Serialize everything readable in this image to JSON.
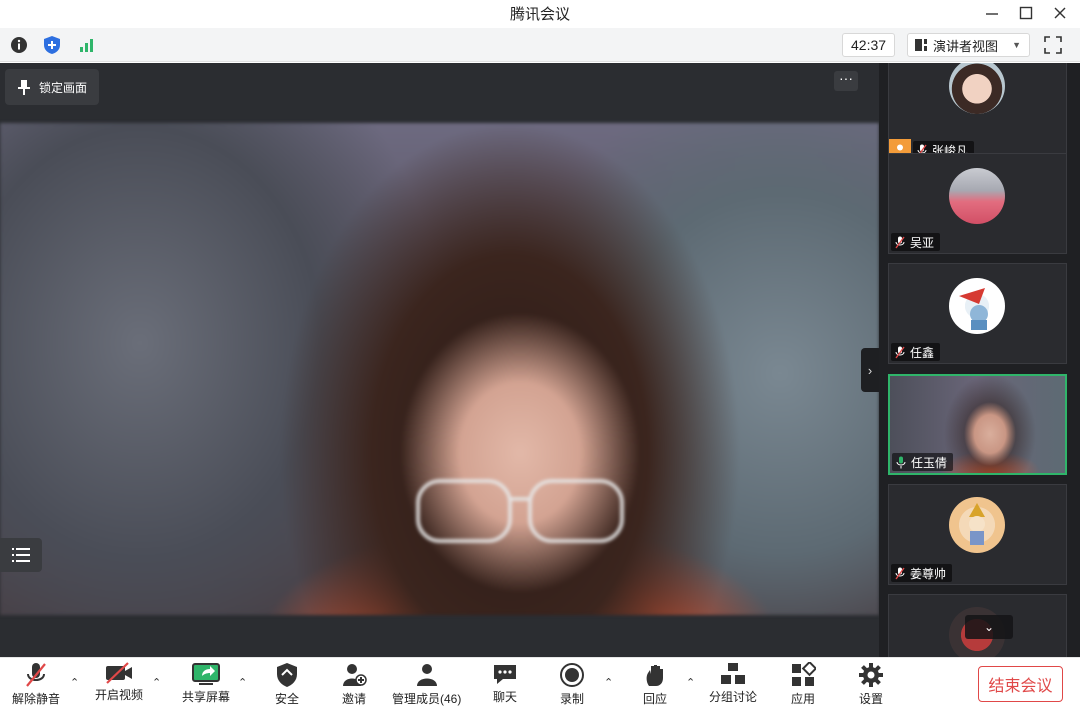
{
  "window": {
    "title": "腾讯会议"
  },
  "toolbar": {
    "timer": "42:37",
    "view_label": "演讲者视图"
  },
  "stage": {
    "lock_label": "锁定画面"
  },
  "participants": [
    {
      "name": "张峻凡"
    },
    {
      "name": "吴亚"
    },
    {
      "name": "任鑫"
    },
    {
      "name": "任玉倩"
    },
    {
      "name": "姜尊帅"
    }
  ],
  "controls": {
    "unmute": "解除静音",
    "start_video": "开启视频",
    "share_screen": "共享屏幕",
    "security": "安全",
    "invite": "邀请",
    "manage_members": "管理成员(46)",
    "chat": "聊天",
    "record": "录制",
    "reactions": "回应",
    "breakout": "分组讨论",
    "apps": "应用",
    "settings": "设置",
    "end_meeting": "结束会议"
  },
  "colors": {
    "accent_green": "#2fb56a",
    "end_red": "#e04848",
    "host_orange": "#f39c3a"
  }
}
